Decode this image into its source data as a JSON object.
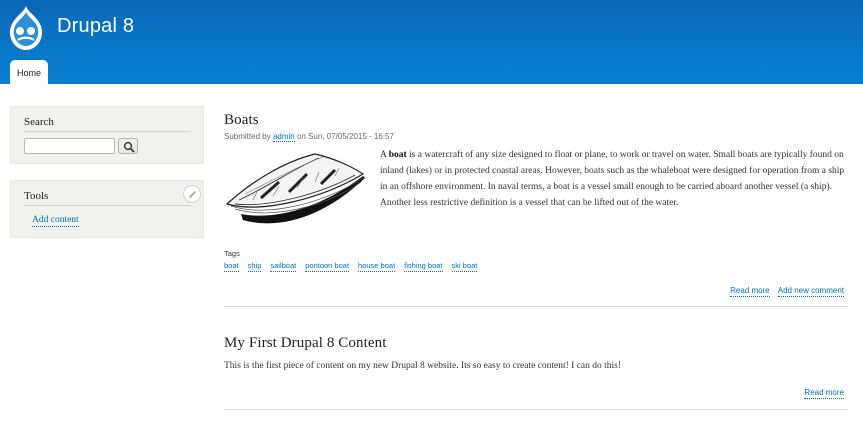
{
  "site": {
    "name": "Drupal 8",
    "logo_icon": "drupal-drop-icon",
    "brand_color": "#0a78c8"
  },
  "nav": {
    "tabs": [
      {
        "label": "Home",
        "active": true
      }
    ]
  },
  "sidebar": {
    "search": {
      "title": "Search",
      "input_value": "",
      "button_icon": "search-icon"
    },
    "tools": {
      "title": "Tools",
      "edit_icon": "pencil-icon",
      "links": [
        {
          "label": "Add content"
        }
      ]
    }
  },
  "articles": [
    {
      "title": "Boats",
      "submitted_prefix": "Submitted by",
      "author": "admin",
      "submitted_suffix": "on Sun, 07/05/2015 - 16:57",
      "image_icon": "rowboat-illustration",
      "body_lead": "A",
      "body_bold": "boat",
      "body_rest": "is a watercraft of any size designed to float or plane, to work or travel on water. Small boats are typically found on inland (lakes) or in protected coastal areas. However, boats such as the whaleboat were designed for operation from a ship in an offshore environment. In naval terms, a boat is a vessel small enough to be carried aboard another vessel (a ship).  Another less restrictive definition is a vessel that can be lifted out of the water.",
      "tags_label": "Tags",
      "tags": [
        "boat",
        "ship",
        "sailboat",
        "pontoon boat",
        "house boat",
        "fishing boat",
        "ski boat"
      ],
      "links": [
        "Read more",
        "Add new comment"
      ]
    },
    {
      "title": "My First Drupal 8 Content",
      "body": "This is the first piece of content on my new Drupal 8 website.  Its so easy to create content!  I can do this!",
      "links": [
        "Read more"
      ]
    }
  ],
  "colors": {
    "link": "#0071b3",
    "sidebar_bg": "#f1f1ed"
  }
}
